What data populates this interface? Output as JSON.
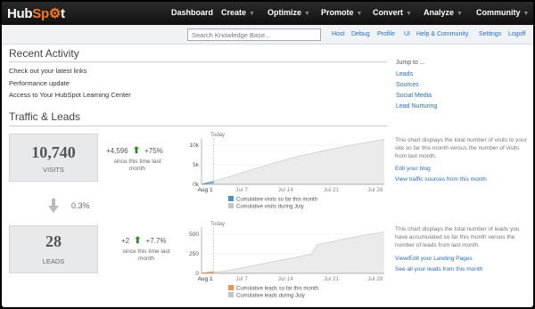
{
  "brand": {
    "text_a": "Hub",
    "text_b": "Sp",
    "text_c": "t"
  },
  "nav": [
    "Dashboard",
    "Create",
    "Optimize",
    "Promote",
    "Convert",
    "Analyze",
    "Community"
  ],
  "search_placeholder": "Search Knowledge Base...",
  "sublinks": [
    "Host",
    "Debug",
    "Profile",
    "UI",
    "Help & Community",
    "Settings",
    "Logoff"
  ],
  "recent": {
    "title": "Recent Activity",
    "items": [
      "Check out your latest links",
      "Performance update",
      "Access to Your HubSpot Learning Center"
    ]
  },
  "jump": {
    "title": "Jump to ...",
    "items": [
      "Leads",
      "Sources",
      "Social Media",
      "Lead Nurturing"
    ]
  },
  "traffic": {
    "title": "Traffic & Leads",
    "visits": {
      "value": "10,740",
      "label": "VISITS",
      "delta": "+4,596",
      "pct": "+75%",
      "since": "since this time last month"
    },
    "conversion": "0.3%",
    "leads": {
      "value": "28",
      "label": "LEADS",
      "delta": "+2",
      "pct": "+7.7%",
      "since": "since this time last month"
    }
  },
  "visits_panel": {
    "desc": "This chart displays the total number of visits to your site so far this month versus the number of visits from last month.",
    "links": [
      "Edit your blog",
      "View traffic sources from this month"
    ]
  },
  "leads_panel": {
    "desc": "This chart displays the total number of leads you have accumulated so far this month versus the number of leads from last month.",
    "links": [
      "View/Edit your Landing Pages",
      "See all your leads from this month"
    ]
  },
  "chart_data": [
    {
      "type": "area",
      "today_label": "Today",
      "x_ticks": [
        "Aug 1",
        "Jul 7",
        "Jul 14",
        "Jul 21",
        "Jul 28"
      ],
      "y_ticks": [
        "0k",
        "5k",
        "10k"
      ],
      "ylim": [
        0,
        12000
      ],
      "series": [
        {
          "name": "Cumulative visits so far this month",
          "color": "#4a90d9",
          "x": [
            1,
            2,
            3
          ],
          "values": [
            0,
            380,
            700
          ]
        },
        {
          "name": "Cumulative visits during July",
          "color": "#c4c4c4",
          "x": [
            1,
            5,
            9,
            13,
            17,
            21,
            25,
            29,
            31
          ],
          "values": [
            0,
            1700,
            3700,
            5600,
            7300,
            8700,
            10000,
            11100,
            11700
          ]
        }
      ]
    },
    {
      "type": "area",
      "today_label": "Today",
      "x_ticks": [
        "Aug 1",
        "Jul 7",
        "Jul 14",
        "Jul 21",
        "Jul 28"
      ],
      "y_ticks": [
        "0",
        "250",
        "500"
      ],
      "ylim": [
        0,
        580
      ],
      "series": [
        {
          "name": "Cumulative leads so far this month",
          "color": "#f0924a",
          "x": [
            1,
            2,
            3
          ],
          "values": [
            0,
            12,
            20
          ]
        },
        {
          "name": "Cumulative leads during July",
          "color": "#c4c4c4",
          "x": [
            1,
            5,
            9,
            13,
            17,
            19,
            20,
            25,
            29,
            31
          ],
          "values": [
            0,
            30,
            90,
            150,
            210,
            240,
            360,
            440,
            495,
            520
          ]
        }
      ]
    }
  ]
}
